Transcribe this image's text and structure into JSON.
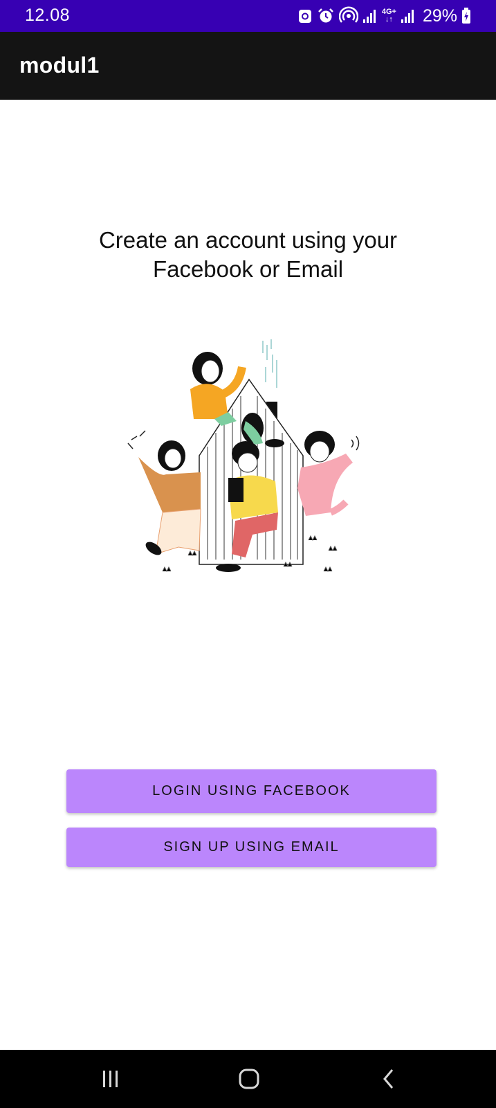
{
  "status_bar": {
    "time": "12.08",
    "battery_percent": "29%",
    "network_label": "4G+",
    "icons": [
      "notification-icon",
      "alarm-icon",
      "hotspot-icon",
      "signal-icon",
      "network-4g-icon",
      "signal-icon",
      "battery-charging-icon"
    ],
    "background": "#3700b3"
  },
  "app_bar": {
    "title": "modul1",
    "background": "#141414"
  },
  "main": {
    "headline_line1": "Create an account using your",
    "headline_line2": "Facebook or Email",
    "illustration_icon": "friends-house-illustration"
  },
  "buttons": {
    "facebook_label": "LOGIN USING FACEBOOK",
    "email_label": "SIGN UP USING EMAIL",
    "color": "#bb86fc"
  },
  "nav_bar": {
    "icons": [
      "recents-icon",
      "home-icon",
      "back-icon"
    ]
  }
}
